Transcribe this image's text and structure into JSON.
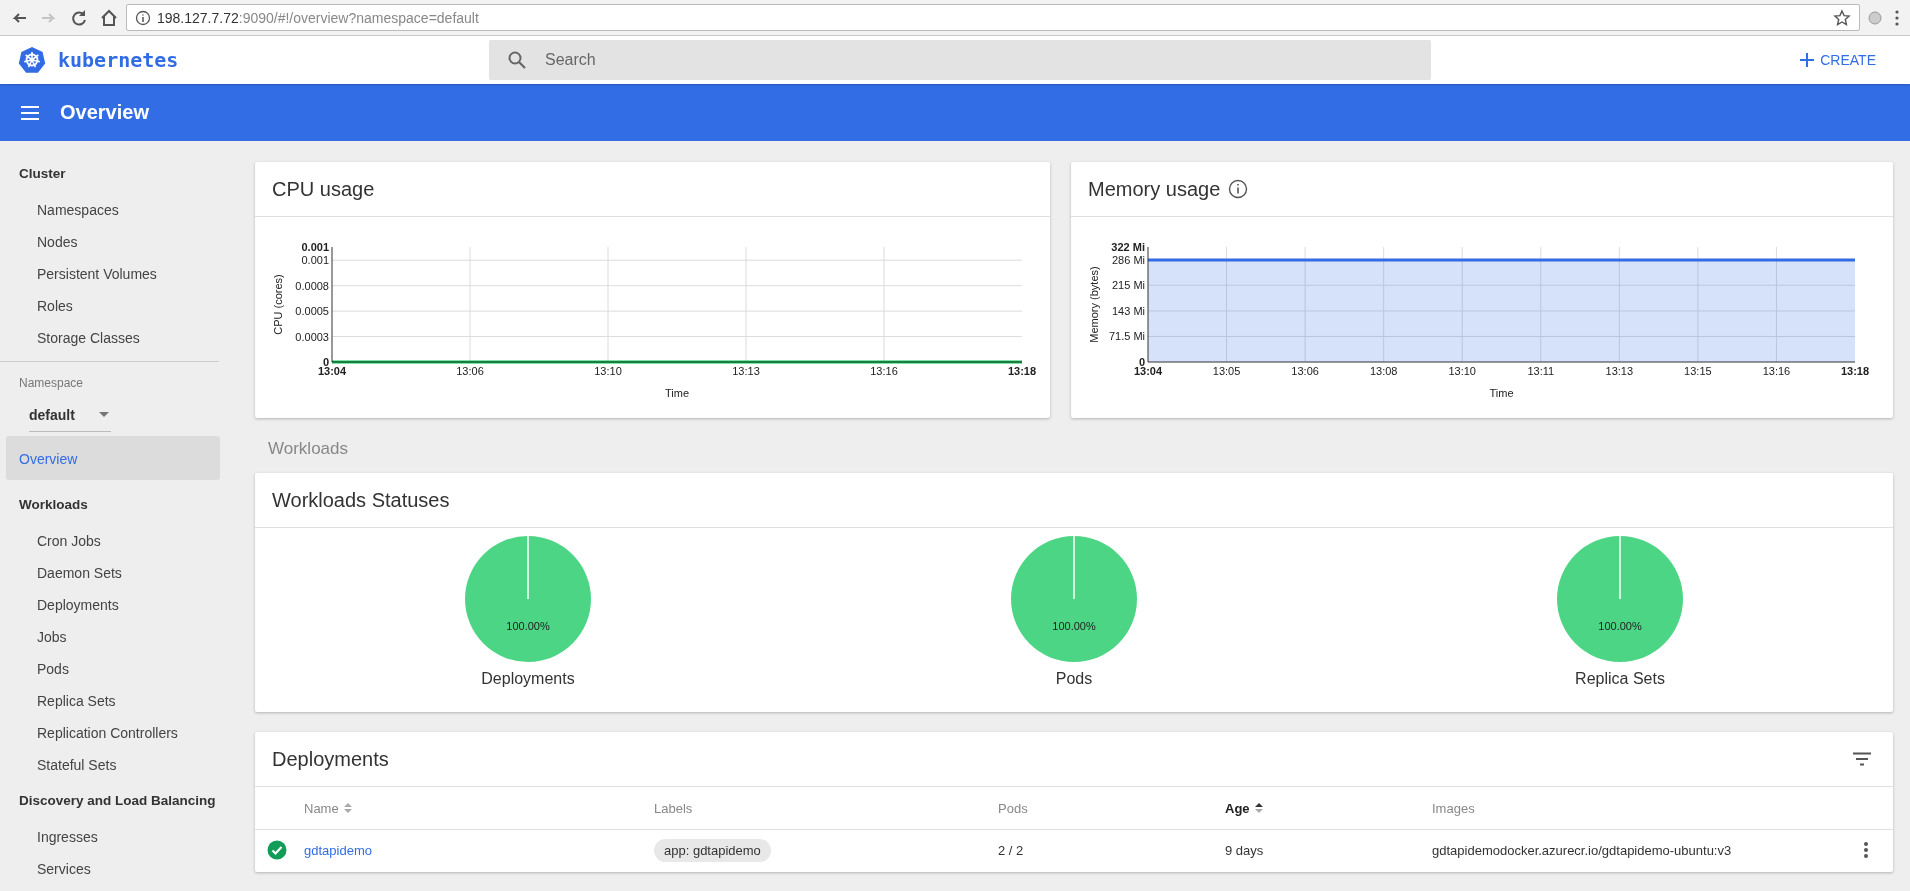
{
  "browser": {
    "nav_buttons": [
      {
        "kind": "back",
        "disabled": false
      },
      {
        "kind": "forward",
        "disabled": true
      },
      {
        "kind": "reload",
        "disabled": false
      },
      {
        "kind": "home",
        "disabled": false
      }
    ],
    "url_host": "198.127.7.72",
    "url_rest": ":9090/#!/overview?namespace=default"
  },
  "app_header": {
    "brand": "kubernetes",
    "search": {
      "placeholder": "Search"
    },
    "create_button": "CREATE"
  },
  "title_bar": {
    "title": "Overview"
  },
  "sidebar": {
    "cluster": [
      {
        "kind": "heading",
        "label": "Cluster",
        "selected": false
      },
      {
        "kind": "item",
        "label": "Namespaces",
        "selected": false
      },
      {
        "kind": "item",
        "label": "Nodes",
        "selected": false
      },
      {
        "kind": "item",
        "label": "Persistent Volumes",
        "selected": false
      },
      {
        "kind": "item",
        "label": "Roles",
        "selected": false
      },
      {
        "kind": "item",
        "label": "Storage Classes",
        "selected": false
      }
    ],
    "namespace": {
      "label": "Namespace",
      "value": "default"
    },
    "nav": [
      {
        "kind": "top",
        "label": "Overview",
        "selected": true
      },
      {
        "kind": "heading",
        "label": "Workloads",
        "selected": false
      },
      {
        "kind": "item",
        "label": "Cron Jobs",
        "selected": false
      },
      {
        "kind": "item",
        "label": "Daemon Sets",
        "selected": false
      },
      {
        "kind": "item",
        "label": "Deployments",
        "selected": false
      },
      {
        "kind": "item",
        "label": "Jobs",
        "selected": false
      },
      {
        "kind": "item",
        "label": "Pods",
        "selected": false
      },
      {
        "kind": "item",
        "label": "Replica Sets",
        "selected": false
      },
      {
        "kind": "item",
        "label": "Replication Controllers",
        "selected": false
      },
      {
        "kind": "item",
        "label": "Stateful Sets",
        "selected": false
      },
      {
        "kind": "heading",
        "label": "Discovery and Load Balancing",
        "selected": false
      },
      {
        "kind": "item",
        "label": "Ingresses",
        "selected": false
      },
      {
        "kind": "item",
        "label": "Services",
        "selected": false
      }
    ]
  },
  "cpu_card": {
    "title": "CPU usage",
    "chart_data": {
      "type": "line",
      "xlabel": "Time",
      "ylabel": "CPU (cores)",
      "categories": [
        "13:04",
        "13:06",
        "13:10",
        "13:13",
        "13:16",
        "13:18"
      ],
      "series": [
        {
          "color": "#00c752",
          "values": [
            0,
            0,
            0,
            0,
            0,
            0
          ]
        }
      ],
      "grid": true,
      "ylim": [
        0,
        0.00113
      ],
      "yticks": [
        {
          "value": 0,
          "label": "0"
        },
        {
          "value": 0.00025,
          "label": "0.0003"
        },
        {
          "value": 0.0005,
          "label": "0.0005"
        },
        {
          "value": 0.00075,
          "label": "0.0008"
        },
        {
          "value": 0.001,
          "label": "0.001"
        },
        {
          "value": 0.00113,
          "label": "0.001"
        }
      ]
    }
  },
  "memory_card": {
    "title": "Memory usage",
    "chart_data": {
      "type": "area",
      "xlabel": "Time",
      "ylabel": "Memory (bytes)",
      "categories": [
        "13:04",
        "13:05",
        "13:06",
        "13:08",
        "13:10",
        "13:11",
        "13:13",
        "13:15",
        "13:16",
        "13:18"
      ],
      "series": [
        {
          "color": "#326de6",
          "values": [
            286,
            286,
            286,
            286,
            286,
            286,
            286,
            286,
            286,
            286
          ]
        }
      ],
      "grid": true,
      "ylim": [
        0,
        322
      ],
      "yticks": [
        {
          "value": 0,
          "label": "0"
        },
        {
          "value": 71.5,
          "label": "71.5 Mi"
        },
        {
          "value": 143,
          "label": "143 Mi"
        },
        {
          "value": 215,
          "label": "215 Mi"
        },
        {
          "value": 286,
          "label": "286 Mi"
        },
        {
          "value": 322,
          "label": "322 Mi"
        }
      ]
    }
  },
  "workloads_label": "Workloads",
  "statuses_card": {
    "title": "Workloads Statuses",
    "pies": [
      {
        "chart_data": {
          "type": "pie",
          "title": "Deployments",
          "series": [
            {
              "color": "#4cd585",
              "values": [
                100
              ]
            }
          ],
          "value_labels": [
            "100.00%"
          ]
        }
      },
      {
        "chart_data": {
          "type": "pie",
          "title": "Pods",
          "series": [
            {
              "color": "#4cd585",
              "values": [
                100
              ]
            }
          ],
          "value_labels": [
            "100.00%"
          ]
        }
      },
      {
        "chart_data": {
          "type": "pie",
          "title": "Replica Sets",
          "series": [
            {
              "color": "#4cd585",
              "values": [
                100
              ]
            }
          ],
          "value_labels": [
            "100.00%"
          ]
        }
      }
    ]
  },
  "deployments_card": {
    "title": "Deployments",
    "columns": [
      {
        "label": "Name",
        "sortable": true,
        "sorted": false
      },
      {
        "label": "Labels",
        "sortable": false,
        "sorted": false
      },
      {
        "label": "Pods",
        "sortable": false,
        "sorted": false
      },
      {
        "label": "Age",
        "sortable": true,
        "sorted": true
      },
      {
        "label": "Images",
        "sortable": false,
        "sorted": false
      }
    ],
    "rows": [
      {
        "healthy": true,
        "name": "gdtapidemo",
        "labels": [
          "app: gdtapidemo"
        ],
        "pods": "2 / 2",
        "age": "9 days",
        "images": "gdtapidemodocker.azurecr.io/gdtapidemo-ubuntu:v3"
      }
    ]
  }
}
